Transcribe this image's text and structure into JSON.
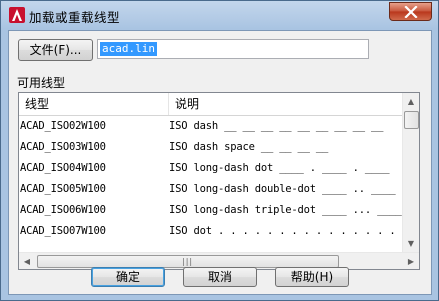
{
  "window": {
    "title": "加载或重载线型"
  },
  "file": {
    "button_label": "文件(F)...",
    "value": "acad.lin"
  },
  "list": {
    "group_label": "可用线型",
    "columns": [
      "线型",
      "说明"
    ],
    "rows": [
      {
        "name": "ACAD_ISO02W100",
        "desc": "ISO dash __ __ __ __ __ __ __ __ __"
      },
      {
        "name": "ACAD_ISO03W100",
        "desc": "ISO dash space __    __    __    __"
      },
      {
        "name": "ACAD_ISO04W100",
        "desc": "ISO long-dash dot ____ . ____ . ____"
      },
      {
        "name": "ACAD_ISO05W100",
        "desc": "ISO long-dash double-dot ____ .. ____"
      },
      {
        "name": "ACAD_ISO06W100",
        "desc": "ISO long-dash triple-dot ____ ... ____"
      },
      {
        "name": "ACAD_ISO07W100",
        "desc": "ISO dot . . . . . . . . . . . . . . . ."
      }
    ]
  },
  "buttons": {
    "ok": "确定",
    "cancel": "取消",
    "help": "帮助(H)"
  }
}
